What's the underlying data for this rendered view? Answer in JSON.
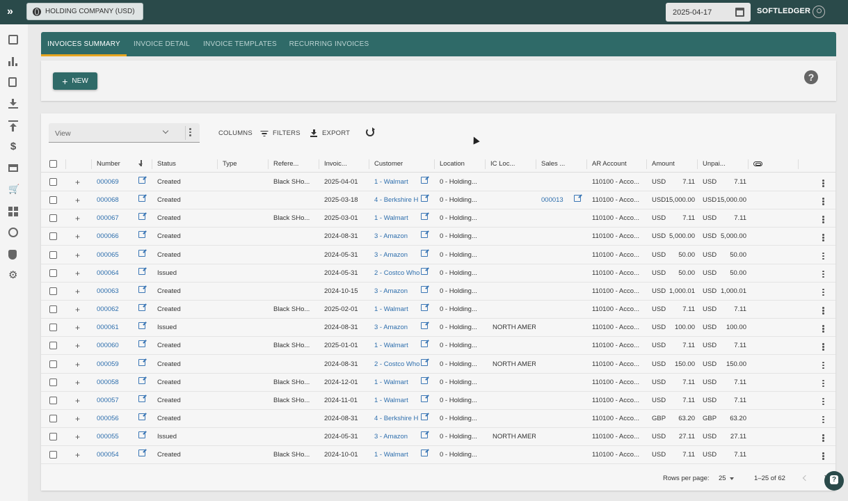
{
  "topbar": {
    "company": "HOLDING COMPANY (USD)",
    "date": "2025-04-17",
    "brand": "SOFTLEDGER"
  },
  "tabs": [
    {
      "label": "INVOICES SUMMARY",
      "active": true
    },
    {
      "label": "INVOICE DETAIL",
      "active": false
    },
    {
      "label": "INVOICE TEMPLATES",
      "active": false
    },
    {
      "label": "RECURRING INVOICES",
      "active": false
    }
  ],
  "actions": {
    "new_label": "NEW"
  },
  "toolbar": {
    "view_placeholder": "View",
    "columns_label": "COLUMNS",
    "filters_label": "FILTERS",
    "export_label": "EXPORT"
  },
  "table": {
    "headers": {
      "number": "Number",
      "status": "Status",
      "type": "Type",
      "reference": "Refere...",
      "invoice_date": "Invoic...",
      "customer": "Customer",
      "location": "Location",
      "ic_location": "IC Loc...",
      "sales": "Sales ...",
      "ar_account": "AR Account",
      "amount": "Amount",
      "unpaid": "Unpai..."
    },
    "rows": [
      {
        "number": "000069",
        "status": "Created",
        "reference": "Black SHo...",
        "date": "2025-04-01",
        "customer": "1 - Walmart",
        "location": "0 - Holding...",
        "ic_loc": "",
        "sales": "",
        "ar": "110100 - Acco...",
        "amt_cur": "USD",
        "amt": "7.11",
        "unp_cur": "USD",
        "unp": "7.11"
      },
      {
        "number": "000068",
        "status": "Created",
        "reference": "",
        "date": "2025-03-18",
        "customer": "4 - Berkshire H",
        "location": "0 - Holding...",
        "ic_loc": "",
        "sales": "000013",
        "ar": "110100 - Acco...",
        "amt_cur": "USD",
        "amt": "15,000.00",
        "unp_cur": "USD",
        "unp": "15,000.00"
      },
      {
        "number": "000067",
        "status": "Created",
        "reference": "Black SHo...",
        "date": "2025-03-01",
        "customer": "1 - Walmart",
        "location": "0 - Holding...",
        "ic_loc": "",
        "sales": "",
        "ar": "110100 - Acco...",
        "amt_cur": "USD",
        "amt": "7.11",
        "unp_cur": "USD",
        "unp": "7.11"
      },
      {
        "number": "000066",
        "status": "Created",
        "reference": "",
        "date": "2024-08-31",
        "customer": "3 - Amazon",
        "location": "0 - Holding...",
        "ic_loc": "",
        "sales": "",
        "ar": "110100 - Acco...",
        "amt_cur": "USD",
        "amt": "5,000.00",
        "unp_cur": "USD",
        "unp": "5,000.00"
      },
      {
        "number": "000065",
        "status": "Created",
        "reference": "",
        "date": "2024-05-31",
        "customer": "3 - Amazon",
        "location": "0 - Holding...",
        "ic_loc": "",
        "sales": "",
        "ar": "110100 - Acco...",
        "amt_cur": "USD",
        "amt": "50.00",
        "unp_cur": "USD",
        "unp": "50.00"
      },
      {
        "number": "000064",
        "status": "Issued",
        "reference": "",
        "date": "2024-05-31",
        "customer": "2 - Costco Who",
        "location": "0 - Holding...",
        "ic_loc": "",
        "sales": "",
        "ar": "110100 - Acco...",
        "amt_cur": "USD",
        "amt": "50.00",
        "unp_cur": "USD",
        "unp": "50.00"
      },
      {
        "number": "000063",
        "status": "Created",
        "reference": "",
        "date": "2024-10-15",
        "customer": "3 - Amazon",
        "location": "0 - Holding...",
        "ic_loc": "",
        "sales": "",
        "ar": "110100 - Acco...",
        "amt_cur": "USD",
        "amt": "1,000.01",
        "unp_cur": "USD",
        "unp": "1,000.01"
      },
      {
        "number": "000062",
        "status": "Created",
        "reference": "Black SHo...",
        "date": "2025-02-01",
        "customer": "1 - Walmart",
        "location": "0 - Holding...",
        "ic_loc": "",
        "sales": "",
        "ar": "110100 - Acco...",
        "amt_cur": "USD",
        "amt": "7.11",
        "unp_cur": "USD",
        "unp": "7.11"
      },
      {
        "number": "000061",
        "status": "Issued",
        "reference": "",
        "date": "2024-08-31",
        "customer": "3 - Amazon",
        "location": "0 - Holding...",
        "ic_loc": "NORTH AMER",
        "sales": "",
        "ar": "110100 - Acco...",
        "amt_cur": "USD",
        "amt": "100.00",
        "unp_cur": "USD",
        "unp": "100.00"
      },
      {
        "number": "000060",
        "status": "Created",
        "reference": "Black SHo...",
        "date": "2025-01-01",
        "customer": "1 - Walmart",
        "location": "0 - Holding...",
        "ic_loc": "",
        "sales": "",
        "ar": "110100 - Acco...",
        "amt_cur": "USD",
        "amt": "7.11",
        "unp_cur": "USD",
        "unp": "7.11"
      },
      {
        "number": "000059",
        "status": "Created",
        "reference": "",
        "date": "2024-08-31",
        "customer": "2 - Costco Who",
        "location": "0 - Holding...",
        "ic_loc": "NORTH AMER",
        "sales": "",
        "ar": "110100 - Acco...",
        "amt_cur": "USD",
        "amt": "150.00",
        "unp_cur": "USD",
        "unp": "150.00"
      },
      {
        "number": "000058",
        "status": "Created",
        "reference": "Black SHo...",
        "date": "2024-12-01",
        "customer": "1 - Walmart",
        "location": "0 - Holding...",
        "ic_loc": "",
        "sales": "",
        "ar": "110100 - Acco...",
        "amt_cur": "USD",
        "amt": "7.11",
        "unp_cur": "USD",
        "unp": "7.11"
      },
      {
        "number": "000057",
        "status": "Created",
        "reference": "Black SHo...",
        "date": "2024-11-01",
        "customer": "1 - Walmart",
        "location": "0 - Holding...",
        "ic_loc": "",
        "sales": "",
        "ar": "110100 - Acco...",
        "amt_cur": "USD",
        "amt": "7.11",
        "unp_cur": "USD",
        "unp": "7.11"
      },
      {
        "number": "000056",
        "status": "Created",
        "reference": "",
        "date": "2024-08-31",
        "customer": "4 - Berkshire H",
        "location": "0 - Holding...",
        "ic_loc": "",
        "sales": "",
        "ar": "110100 - Acco...",
        "amt_cur": "GBP",
        "amt": "63.20",
        "unp_cur": "GBP",
        "unp": "63.20"
      },
      {
        "number": "000055",
        "status": "Issued",
        "reference": "",
        "date": "2024-05-31",
        "customer": "3 - Amazon",
        "location": "0 - Holding...",
        "ic_loc": "NORTH AMER",
        "sales": "",
        "ar": "110100 - Acco...",
        "amt_cur": "USD",
        "amt": "27.11",
        "unp_cur": "USD",
        "unp": "27.11"
      },
      {
        "number": "000054",
        "status": "Created",
        "reference": "Black SHo...",
        "date": "2024-10-01",
        "customer": "1 - Walmart",
        "location": "0 - Holding...",
        "ic_loc": "",
        "sales": "",
        "ar": "110100 - Acco...",
        "amt_cur": "USD",
        "amt": "7.11",
        "unp_cur": "USD",
        "unp": "7.11"
      }
    ]
  },
  "footer": {
    "rows_per_page_label": "Rows per page:",
    "rows_per_page": "25",
    "range": "1–25 of 62"
  },
  "colors": {
    "topbar": "#2a4a4a",
    "tabbar": "#2f6a68",
    "active_tab_underline": "#e6a520",
    "link": "#2f6fad"
  },
  "icons": [
    "expand-icon",
    "globe-icon",
    "calendar-icon",
    "user-icon",
    "help-icon",
    "columns-icon",
    "filter-icon",
    "export-icon",
    "refresh-icon",
    "sort-arrow-icon",
    "attachment-icon",
    "external-link-icon",
    "kebab-icon",
    "chat-icon"
  ]
}
